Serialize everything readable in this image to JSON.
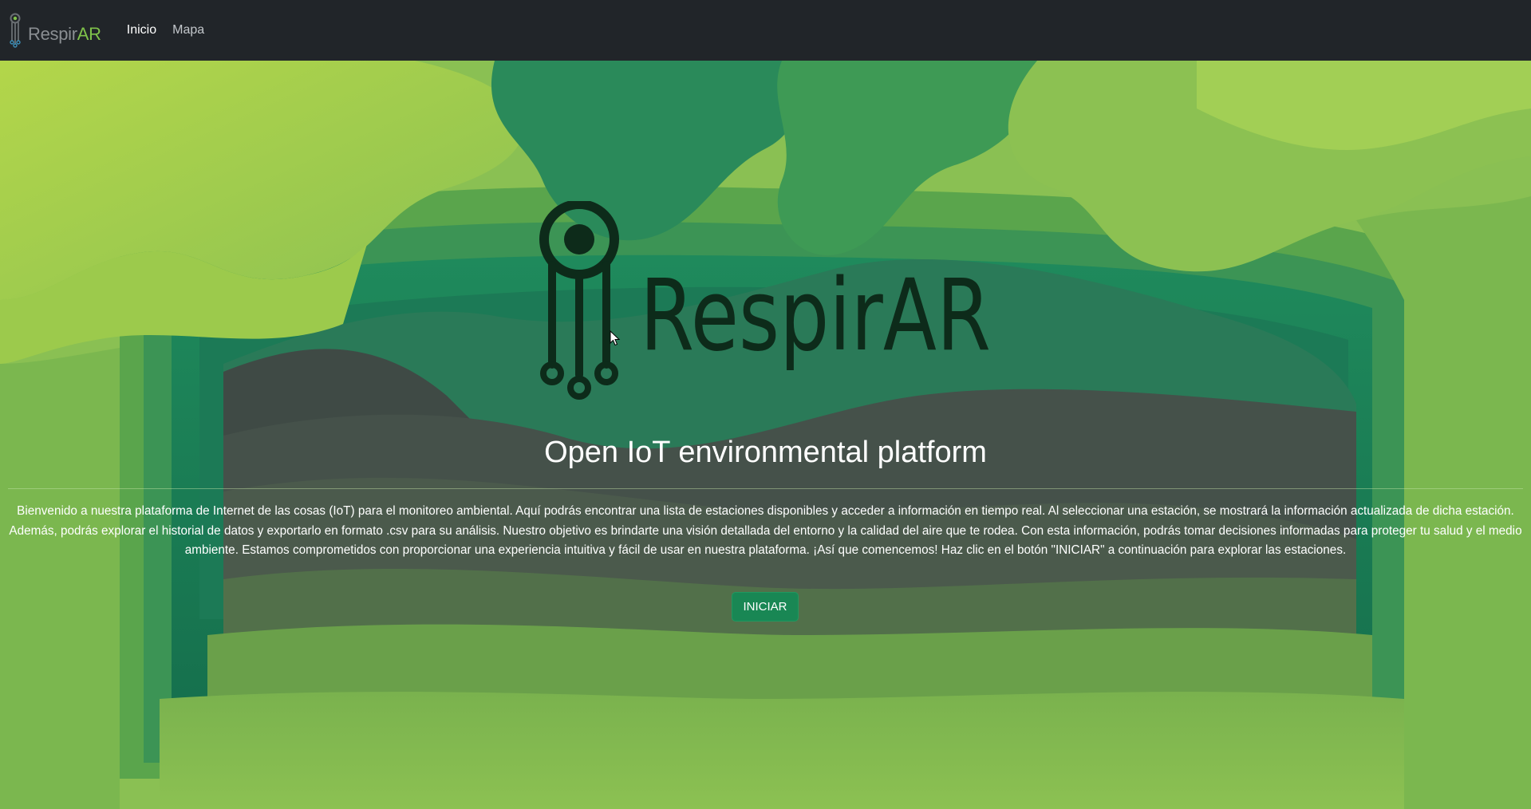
{
  "navbar": {
    "brand": {
      "prefix": "Respir",
      "suffix": "AR"
    },
    "links": [
      {
        "label": "Inicio",
        "active": true
      },
      {
        "label": "Mapa",
        "active": false
      }
    ]
  },
  "hero": {
    "logo_text": "RespirAR",
    "tagline": "Open IoT environmental platform",
    "description": "Bienvenido a nuestra plataforma de Internet de las cosas (IoT) para el monitoreo ambiental. Aquí podrás encontrar una lista de estaciones disponibles y acceder a información en tiempo real. Al seleccionar una estación, se mostrará la información actualizada de dicha estación. Además, podrás explorar el historial de datos y exportarlo en formato .csv para su análisis. Nuestro objetivo es brindarte una visión detallada del entorno y la calidad del aire que te rodea. Con esta información, podrás tomar decisiones informadas para proteger tu salud y el medio ambiente. Estamos comprometidos con proporcionar una experiencia intuitiva y fácil de usar en nuestra plataforma. ¡Así que comencemos! Haz clic en el botón \"INICIAR\" a continuación para explorar las estaciones.",
    "start_button": "INICIAR"
  },
  "colors": {
    "navbar_bg": "#212529",
    "brand_accent": "#7fc24a",
    "button_bg": "#198754",
    "hero_light": "#a6d24c",
    "hero_dark": "#1a7a55",
    "hero_grey": "#45514a"
  },
  "icons": {
    "brand_logo": "respirar-sensor-icon",
    "cursor": "mouse-pointer-icon"
  }
}
